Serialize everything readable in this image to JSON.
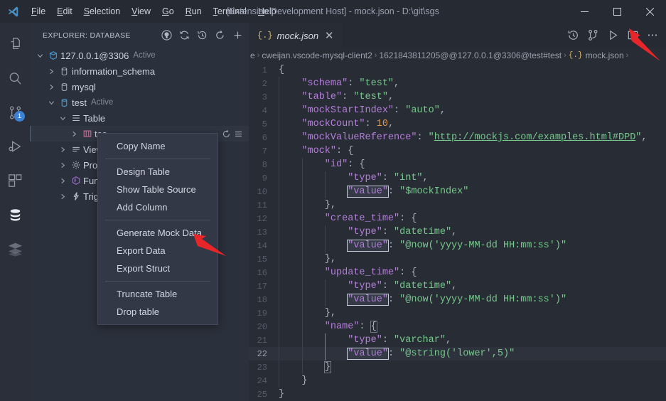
{
  "window": {
    "title": "[Extension Development Host] - mock.json - D:\\git\\sgs",
    "minimize": "—",
    "maximize": "☐",
    "close": "✕"
  },
  "menubar": {
    "items": [
      {
        "label": "File",
        "accel": "F",
        "rest": "ile"
      },
      {
        "label": "Edit",
        "accel": "E",
        "rest": "dit"
      },
      {
        "label": "Selection",
        "accel": "S",
        "rest": "election"
      },
      {
        "label": "View",
        "accel": "V",
        "rest": "iew"
      },
      {
        "label": "Go",
        "accel": "G",
        "rest": "o"
      },
      {
        "label": "Run",
        "accel": "R",
        "rest": "un"
      },
      {
        "label": "Terminal",
        "accel": "T",
        "rest": "erminal"
      },
      {
        "label": "Help",
        "accel": "H",
        "rest": "elp"
      }
    ]
  },
  "activitybar": {
    "items": [
      {
        "name": "explorer-icon",
        "label": "Explorer",
        "active": false
      },
      {
        "name": "search-icon",
        "label": "Search",
        "active": false
      },
      {
        "name": "source-control-icon",
        "label": "Source Control",
        "active": false,
        "badge": "1"
      },
      {
        "name": "run-debug-icon",
        "label": "Run and Debug",
        "active": false
      },
      {
        "name": "extensions-icon",
        "label": "Extensions",
        "active": false
      },
      {
        "name": "database-icon",
        "label": "Database",
        "active": true
      },
      {
        "name": "nosql-icon",
        "label": "NoSQL",
        "active": false
      }
    ]
  },
  "sidebar": {
    "title": "EXPLORER: DATABASE",
    "actions": [
      {
        "name": "github-icon",
        "label": "GitHub"
      },
      {
        "name": "sync-icon",
        "label": "Sync"
      },
      {
        "name": "history-icon",
        "label": "History"
      },
      {
        "name": "refresh-icon",
        "label": "Refresh"
      },
      {
        "name": "add-connection-icon",
        "label": "Add Connection"
      }
    ],
    "tree": [
      {
        "label": "127.0.0.1@3306",
        "sub": "Active",
        "indent": 0,
        "twisty": "down",
        "icon": "connection-icon"
      },
      {
        "label": "information_schema",
        "sub": "",
        "indent": 1,
        "twisty": "right",
        "icon": "database-schema-icon"
      },
      {
        "label": "mysql",
        "sub": "",
        "indent": 1,
        "twisty": "right",
        "icon": "database-schema-icon"
      },
      {
        "label": "test",
        "sub": "Active",
        "indent": 1,
        "twisty": "down",
        "icon": "database-schema-active-icon"
      },
      {
        "label": "Table",
        "sub": "",
        "indent": 2,
        "twisty": "down",
        "icon": "table-group-icon"
      },
      {
        "label": "tes",
        "sub": "",
        "indent": 3,
        "twisty": "right",
        "icon": "table-icon",
        "selected": true,
        "rowActions": [
          "refresh-icon",
          "menu-icon"
        ]
      },
      {
        "label": "View",
        "sub": "",
        "indent": 2,
        "twisty": "right",
        "icon": "view-group-icon"
      },
      {
        "label": "Proc",
        "sub": "",
        "indent": 2,
        "twisty": "right",
        "icon": "procedure-icon"
      },
      {
        "label": "Func",
        "sub": "",
        "indent": 2,
        "twisty": "right",
        "icon": "function-icon"
      },
      {
        "label": "Trigg",
        "sub": "",
        "indent": 2,
        "twisty": "right",
        "icon": "trigger-icon"
      }
    ]
  },
  "context_menu": {
    "groups": [
      [
        "Copy Name"
      ],
      [
        "Design Table",
        "Show Table Source",
        "Add Column"
      ],
      [
        "Generate Mock Data",
        "Export Data",
        "Export Struct"
      ],
      [
        "Truncate Table",
        "Drop table"
      ]
    ]
  },
  "editor": {
    "tab": {
      "label": "mock.json",
      "icon": "{.}",
      "close": "✕"
    },
    "actions": [
      {
        "name": "timeline-icon",
        "label": "Open Timeline"
      },
      {
        "name": "compare-changes-icon",
        "label": "Compare Changes"
      },
      {
        "name": "run-icon",
        "label": "Run"
      },
      {
        "name": "split-editor-icon",
        "label": "Split Editor"
      },
      {
        "name": "more-actions-icon",
        "label": "More Actions..."
      }
    ],
    "breadcrumb": [
      "e",
      "cweijan.vscode-mysql-client2",
      "1621843811205@@127.0.0.1@3306@test#test",
      "mock.json"
    ],
    "active_line": 22,
    "lines": [
      {
        "n": 1,
        "tokens": [
          {
            "t": "{",
            "c": "p"
          }
        ],
        "indentGuides": []
      },
      {
        "n": 2,
        "tokens": [
          {
            "t": "    \"schema\"",
            "c": "k"
          },
          {
            "t": ": ",
            "c": "p"
          },
          {
            "t": "\"test\"",
            "c": "s"
          },
          {
            "t": ",",
            "c": "p"
          }
        ],
        "indentGuides": [
          1
        ]
      },
      {
        "n": 3,
        "tokens": [
          {
            "t": "    \"table\"",
            "c": "k"
          },
          {
            "t": ": ",
            "c": "p"
          },
          {
            "t": "\"test\"",
            "c": "s"
          },
          {
            "t": ",",
            "c": "p"
          }
        ],
        "indentGuides": [
          1
        ]
      },
      {
        "n": 4,
        "tokens": [
          {
            "t": "    \"mockStartIndex\"",
            "c": "k"
          },
          {
            "t": ": ",
            "c": "p"
          },
          {
            "t": "\"auto\"",
            "c": "s"
          },
          {
            "t": ",",
            "c": "p"
          }
        ],
        "indentGuides": [
          1
        ]
      },
      {
        "n": 5,
        "tokens": [
          {
            "t": "    \"mockCount\"",
            "c": "k"
          },
          {
            "t": ": ",
            "c": "p"
          },
          {
            "t": "10",
            "c": "n"
          },
          {
            "t": ",",
            "c": "p"
          }
        ],
        "indentGuides": [
          1
        ]
      },
      {
        "n": 6,
        "tokens": [
          {
            "t": "    \"mockValueReference\"",
            "c": "k"
          },
          {
            "t": ": ",
            "c": "p"
          },
          {
            "t": "\"",
            "c": "s"
          },
          {
            "t": "http://mockjs.com/examples.html#DPD",
            "c": "link"
          },
          {
            "t": "\"",
            "c": "s"
          },
          {
            "t": ",",
            "c": "p"
          }
        ],
        "indentGuides": [
          1
        ]
      },
      {
        "n": 7,
        "tokens": [
          {
            "t": "    \"mock\"",
            "c": "k"
          },
          {
            "t": ": {",
            "c": "p"
          }
        ],
        "indentGuides": [
          1
        ]
      },
      {
        "n": 8,
        "tokens": [
          {
            "t": "        \"id\"",
            "c": "k"
          },
          {
            "t": ": {",
            "c": "p"
          }
        ],
        "indentGuides": [
          1,
          2
        ]
      },
      {
        "n": 9,
        "tokens": [
          {
            "t": "            \"type\"",
            "c": "k"
          },
          {
            "t": ": ",
            "c": "p"
          },
          {
            "t": "\"int\"",
            "c": "s"
          },
          {
            "t": ",",
            "c": "p"
          }
        ],
        "indentGuides": [
          1,
          2,
          3
        ]
      },
      {
        "n": 10,
        "tokens": [
          {
            "t": "            ",
            "c": "p"
          },
          {
            "t": "\"value\"",
            "c": "k",
            "box": true
          },
          {
            "t": ": ",
            "c": "p"
          },
          {
            "t": "\"$mockIndex\"",
            "c": "s"
          }
        ],
        "indentGuides": [
          1,
          2,
          3
        ]
      },
      {
        "n": 11,
        "tokens": [
          {
            "t": "        },",
            "c": "p"
          }
        ],
        "indentGuides": [
          1,
          2
        ]
      },
      {
        "n": 12,
        "tokens": [
          {
            "t": "        \"create_time\"",
            "c": "k"
          },
          {
            "t": ": {",
            "c": "p"
          }
        ],
        "indentGuides": [
          1,
          2
        ]
      },
      {
        "n": 13,
        "tokens": [
          {
            "t": "            \"type\"",
            "c": "k"
          },
          {
            "t": ": ",
            "c": "p"
          },
          {
            "t": "\"datetime\"",
            "c": "s"
          },
          {
            "t": ",",
            "c": "p"
          }
        ],
        "indentGuides": [
          1,
          2,
          3
        ]
      },
      {
        "n": 14,
        "tokens": [
          {
            "t": "            ",
            "c": "p"
          },
          {
            "t": "\"value\"",
            "c": "k",
            "box": true
          },
          {
            "t": ": ",
            "c": "p"
          },
          {
            "t": "\"@now('yyyy-MM-dd HH:mm:ss')\"",
            "c": "s"
          }
        ],
        "indentGuides": [
          1,
          2,
          3
        ]
      },
      {
        "n": 15,
        "tokens": [
          {
            "t": "        },",
            "c": "p"
          }
        ],
        "indentGuides": [
          1,
          2
        ]
      },
      {
        "n": 16,
        "tokens": [
          {
            "t": "        \"update_time\"",
            "c": "k"
          },
          {
            "t": ": {",
            "c": "p"
          }
        ],
        "indentGuides": [
          1,
          2
        ]
      },
      {
        "n": 17,
        "tokens": [
          {
            "t": "            \"type\"",
            "c": "k"
          },
          {
            "t": ": ",
            "c": "p"
          },
          {
            "t": "\"datetime\"",
            "c": "s"
          },
          {
            "t": ",",
            "c": "p"
          }
        ],
        "indentGuides": [
          1,
          2,
          3
        ]
      },
      {
        "n": 18,
        "tokens": [
          {
            "t": "            ",
            "c": "p"
          },
          {
            "t": "\"value\"",
            "c": "k",
            "box": true
          },
          {
            "t": ": ",
            "c": "p"
          },
          {
            "t": "\"@now('yyyy-MM-dd HH:mm:ss')\"",
            "c": "s"
          }
        ],
        "indentGuides": [
          1,
          2,
          3
        ]
      },
      {
        "n": 19,
        "tokens": [
          {
            "t": "        },",
            "c": "p"
          }
        ],
        "indentGuides": [
          1,
          2
        ]
      },
      {
        "n": 20,
        "tokens": [
          {
            "t": "        \"name\"",
            "c": "k"
          },
          {
            "t": ": ",
            "c": "p"
          },
          {
            "t": "{",
            "c": "p",
            "brace": true
          }
        ],
        "indentGuides": [
          1,
          2
        ]
      },
      {
        "n": 21,
        "tokens": [
          {
            "t": "            \"type\"",
            "c": "k"
          },
          {
            "t": ": ",
            "c": "p"
          },
          {
            "t": "\"varchar\"",
            "c": "s"
          },
          {
            "t": ",",
            "c": "p"
          }
        ],
        "indentGuides": [
          1,
          2,
          3
        ]
      },
      {
        "n": 22,
        "tokens": [
          {
            "t": "            ",
            "c": "p"
          },
          {
            "t": "\"value\"",
            "c": "k",
            "box": true
          },
          {
            "t": ": ",
            "c": "p"
          },
          {
            "t": "\"@string('lower',5)\"",
            "c": "s"
          }
        ],
        "indentGuides": [
          1,
          2,
          3
        ]
      },
      {
        "n": 23,
        "tokens": [
          {
            "t": "        ",
            "c": "p"
          },
          {
            "t": "}",
            "c": "p",
            "brace": true
          }
        ],
        "indentGuides": [
          1,
          2
        ]
      },
      {
        "n": 24,
        "tokens": [
          {
            "t": "    }",
            "c": "p"
          }
        ],
        "indentGuides": [
          1
        ]
      },
      {
        "n": 25,
        "tokens": [
          {
            "t": "}",
            "c": "p"
          }
        ],
        "indentGuides": []
      }
    ]
  },
  "colors": {
    "editor_bg": "#282c34",
    "sidebar_bg": "#2b313c",
    "titlebar_bg": "#252a33",
    "activitybar_bg": "#2a2f3a",
    "menu_bg": "#323845",
    "key": "#b57edc",
    "string": "#77c98d",
    "number": "#d99a54",
    "badge": "#3c82d4",
    "annotation_arrow": "#e8262a"
  },
  "annotations": [
    {
      "name": "arrow-to-run-button",
      "label": ""
    },
    {
      "name": "arrow-to-generate-mock-data",
      "label": ""
    }
  ]
}
